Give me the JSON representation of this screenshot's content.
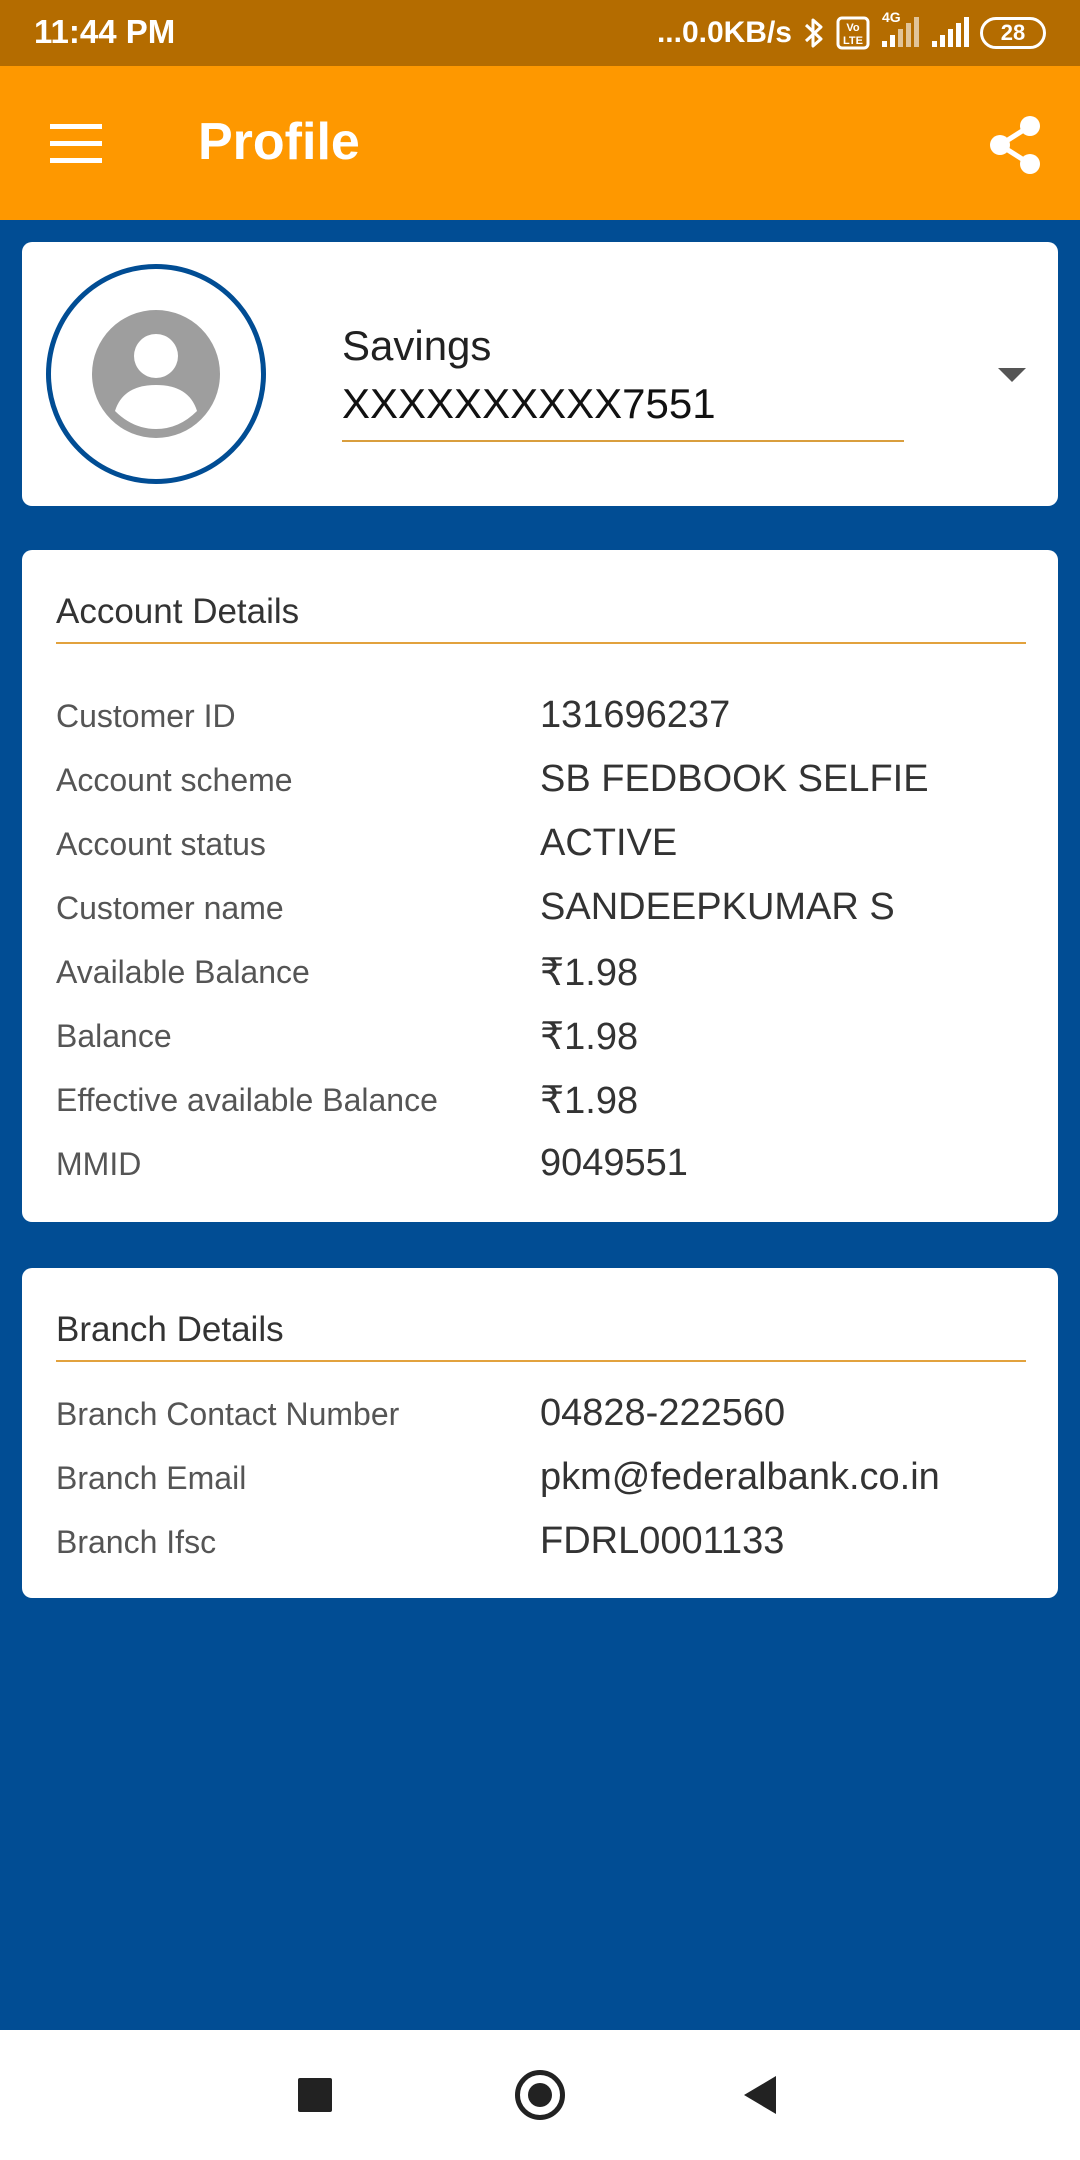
{
  "status_bar": {
    "time": "11:44 PM",
    "network_speed": "...0.0KB/s",
    "volte_label": "Vo LTE",
    "network_type": "4G",
    "battery": "28",
    "icons": [
      "bluetooth-icon",
      "volte-icon",
      "signal-icon",
      "signal-icon",
      "battery-icon"
    ]
  },
  "app_bar": {
    "title": "Profile",
    "menu_icon": "hamburger-menu-icon",
    "share_icon": "share-icon",
    "background": "#fe9800"
  },
  "account": {
    "type": "Savings",
    "number": "XXXXXXXXXX7551",
    "avatar_icon": "person-icon"
  },
  "account_details": {
    "title": "Account Details",
    "rows": [
      {
        "label": "Customer ID",
        "value": "131696237"
      },
      {
        "label": "Account scheme",
        "value": "SB FEDBOOK SELFIE"
      },
      {
        "label": "Account status",
        "value": "ACTIVE"
      },
      {
        "label": "Customer name",
        "value": "SANDEEPKUMAR S"
      },
      {
        "label": "Available Balance",
        "value": "₹1.98"
      },
      {
        "label": "Balance",
        "value": "₹1.98"
      },
      {
        "label": "Effective available Balance",
        "value": "₹1.98"
      },
      {
        "label": "MMID",
        "value": "9049551"
      }
    ]
  },
  "branch_details": {
    "title": "Branch Details",
    "rows": [
      {
        "label": "Branch Contact Number",
        "value": "04828-222560"
      },
      {
        "label": "Branch Email",
        "value": "pkm@federalbank.co.in"
      },
      {
        "label": "Branch Ifsc",
        "value": "FDRL0001133"
      }
    ]
  },
  "nav_bar": {
    "icons": [
      "recents-square-icon",
      "home-circle-icon",
      "back-triangle-icon"
    ]
  },
  "colors": {
    "page_background": "#014d94",
    "status_bar": "#b46c00",
    "accent_divider": "#e2a23d"
  }
}
